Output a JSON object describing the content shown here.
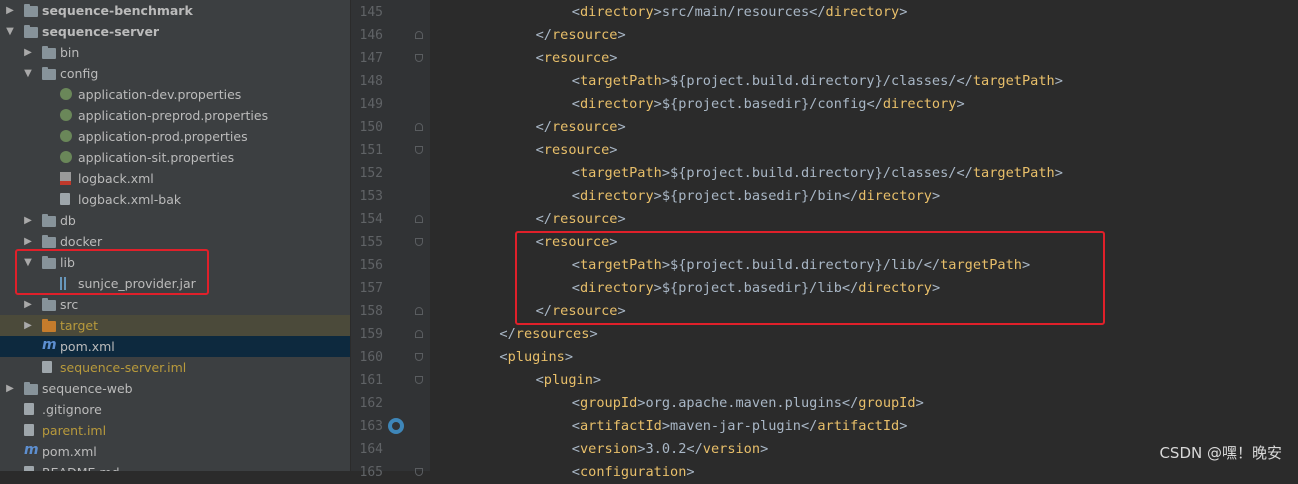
{
  "tree": [
    {
      "label": "sequence-benchmark",
      "indent": 0,
      "arrow": "▶",
      "icon": "module",
      "bold": true
    },
    {
      "label": "sequence-server",
      "indent": 0,
      "arrow": "▼",
      "icon": "module",
      "bold": true
    },
    {
      "label": "bin",
      "indent": 1,
      "arrow": "▶",
      "icon": "folder"
    },
    {
      "label": "config",
      "indent": 1,
      "arrow": "▼",
      "icon": "folder"
    },
    {
      "label": "application-dev.properties",
      "indent": 2,
      "arrow": "",
      "icon": "properties"
    },
    {
      "label": "application-preprod.properties",
      "indent": 2,
      "arrow": "",
      "icon": "properties"
    },
    {
      "label": "application-prod.properties",
      "indent": 2,
      "arrow": "",
      "icon": "properties"
    },
    {
      "label": "application-sit.properties",
      "indent": 2,
      "arrow": "",
      "icon": "properties"
    },
    {
      "label": "logback.xml",
      "indent": 2,
      "arrow": "",
      "icon": "xml"
    },
    {
      "label": "logback.xml-bak",
      "indent": 2,
      "arrow": "",
      "icon": "file"
    },
    {
      "label": "db",
      "indent": 1,
      "arrow": "▶",
      "icon": "folder"
    },
    {
      "label": "docker",
      "indent": 1,
      "arrow": "▶",
      "icon": "folder"
    },
    {
      "label": "lib",
      "indent": 1,
      "arrow": "▼",
      "icon": "folder"
    },
    {
      "label": "sunjce_provider.jar",
      "indent": 2,
      "arrow": "",
      "icon": "jar"
    },
    {
      "label": "src",
      "indent": 1,
      "arrow": "▶",
      "icon": "folder"
    },
    {
      "label": "target",
      "indent": 1,
      "arrow": "▶",
      "icon": "folder-orange",
      "color": "#b89a3c"
    },
    {
      "label": "pom.xml",
      "indent": 1,
      "arrow": "",
      "icon": "maven",
      "selected": true
    },
    {
      "label": "sequence-server.iml",
      "indent": 1,
      "arrow": "",
      "icon": "file",
      "color": "#b89a3c"
    },
    {
      "label": "sequence-web",
      "indent": 0,
      "arrow": "▶",
      "icon": "module"
    },
    {
      "label": ".gitignore",
      "indent": 0,
      "arrow": "",
      "icon": "file"
    },
    {
      "label": "parent.iml",
      "indent": 0,
      "arrow": "",
      "icon": "file",
      "color": "#b89a3c"
    },
    {
      "label": "pom.xml",
      "indent": 0,
      "arrow": "",
      "icon": "maven"
    },
    {
      "label": "README.md",
      "indent": 0,
      "arrow": "",
      "icon": "file"
    }
  ],
  "line_numbers": [
    "145",
    "146",
    "147",
    "148",
    "149",
    "150",
    "151",
    "152",
    "153",
    "154",
    "155",
    "156",
    "157",
    "158",
    "159",
    "160",
    "161",
    "162",
    "163",
    "164",
    "165"
  ],
  "code": [
    {
      "indent": 4,
      "tag": "directory",
      "text": "src/main/resources"
    },
    {
      "indent": 3,
      "close": "resource"
    },
    {
      "indent": 3,
      "open": "resource"
    },
    {
      "indent": 4,
      "tag": "targetPath",
      "text": "${project.build.directory}/classes/"
    },
    {
      "indent": 4,
      "tag": "directory",
      "text": "${project.basedir}/config"
    },
    {
      "indent": 3,
      "close": "resource"
    },
    {
      "indent": 3,
      "open": "resource"
    },
    {
      "indent": 4,
      "tag": "targetPath",
      "text": "${project.build.directory}/classes/"
    },
    {
      "indent": 4,
      "tag": "directory",
      "text": "${project.basedir}/bin"
    },
    {
      "indent": 3,
      "close": "resource"
    },
    {
      "indent": 3,
      "open": "resource"
    },
    {
      "indent": 4,
      "tag": "targetPath",
      "text": "${project.build.directory}/lib/"
    },
    {
      "indent": 4,
      "tag": "directory",
      "text": "${project.basedir}/lib"
    },
    {
      "indent": 3,
      "close": "resource"
    },
    {
      "indent": 2,
      "close": "resources"
    },
    {
      "indent": 2,
      "open": "plugins"
    },
    {
      "indent": 3,
      "open": "plugin"
    },
    {
      "indent": 4,
      "tag": "groupId",
      "text": "org.apache.maven.plugins"
    },
    {
      "indent": 4,
      "tag": "artifactId",
      "text": "maven-jar-plugin"
    },
    {
      "indent": 4,
      "tag": "version",
      "text": "3.0.2"
    },
    {
      "indent": 4,
      "open": "configuration"
    }
  ],
  "watermark": "CSDN @嘿！晚安",
  "colors": {
    "highlight_box": "#e0202a",
    "tag": "#e8bf6a",
    "text": "#a9b7c6"
  }
}
